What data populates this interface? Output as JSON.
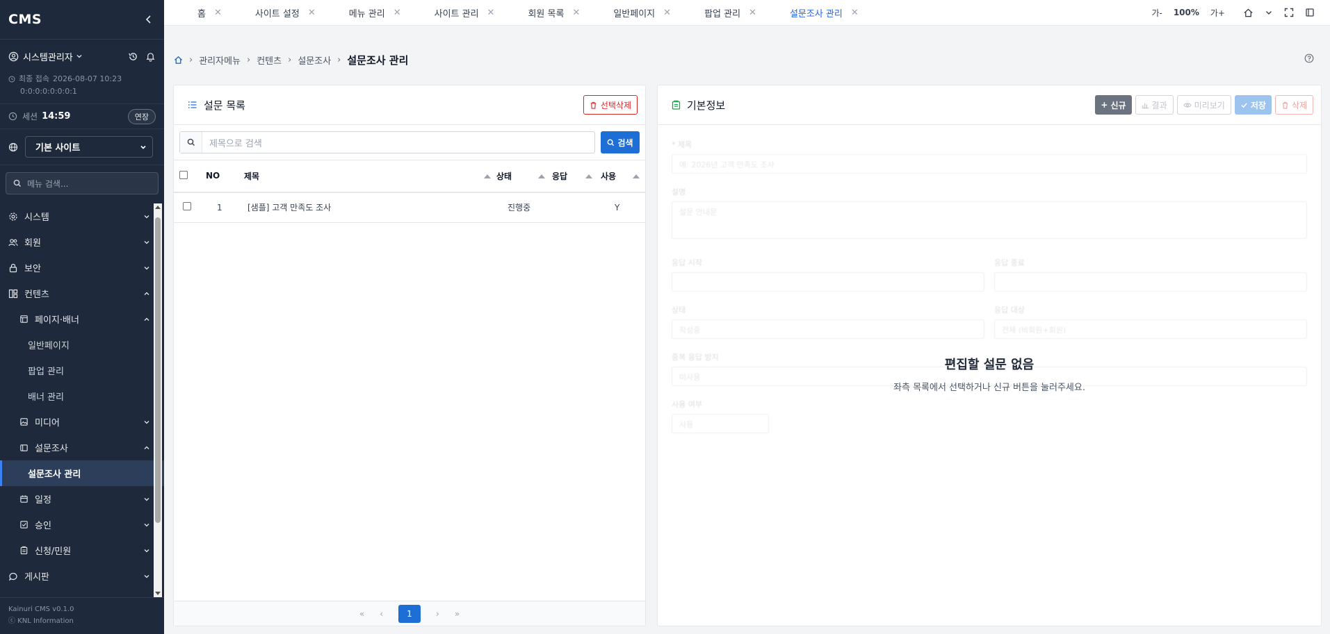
{
  "sidebar": {
    "brand": "CMS",
    "user_name": "시스템관리자",
    "last_login_label": "최종 접속",
    "last_login_time": "2026-08-07 10:23",
    "last_login_ip": "0:0:0:0:0:0:0:1",
    "session_label": "세션",
    "session_time": "14:59",
    "extend_label": "연장",
    "site_select": "기본 사이트",
    "menu_search_placeholder": "메뉴 검색...",
    "menu": [
      {
        "label": "시스템",
        "icon": "gear-icon",
        "expanded": false
      },
      {
        "label": "회원",
        "icon": "users-icon",
        "expanded": false
      },
      {
        "label": "보안",
        "icon": "lock-icon",
        "expanded": false
      },
      {
        "label": "컨텐츠",
        "icon": "grid-icon",
        "expanded": true
      },
      {
        "label": "페이지·배너",
        "icon": "page-icon",
        "expanded": true
      },
      {
        "label": "일반페이지"
      },
      {
        "label": "팝업 관리"
      },
      {
        "label": "배너 관리"
      },
      {
        "label": "미디어",
        "icon": "image-icon",
        "expanded": false
      },
      {
        "label": "설문조사",
        "icon": "survey-icon",
        "expanded": true
      },
      {
        "label": "설문조사 관리",
        "active": true
      },
      {
        "label": "일정",
        "icon": "calendar-icon",
        "expanded": false
      },
      {
        "label": "승인",
        "icon": "check-square-icon",
        "expanded": false
      },
      {
        "label": "신청/민원",
        "icon": "clipboard-icon",
        "expanded": false
      },
      {
        "label": "게시판",
        "icon": "chat-icon",
        "expanded": false
      }
    ],
    "footer_version": "Kainuri CMS v0.1.0",
    "footer_company": "ⓒ KNL Information"
  },
  "tabs": [
    {
      "label": "홈"
    },
    {
      "label": "사이트 설정"
    },
    {
      "label": "메뉴 관리"
    },
    {
      "label": "사이트 관리"
    },
    {
      "label": "회원 목록"
    },
    {
      "label": "일반페이지"
    },
    {
      "label": "팝업 관리"
    },
    {
      "label": "설문조사 관리",
      "active": true
    }
  ],
  "toolbar": {
    "font_down": "가-",
    "zoom": "100%",
    "font_up": "가+"
  },
  "breadcrumb": [
    "관리자메뉴",
    "컨텐츠",
    "설문조사",
    "설문조사 관리"
  ],
  "list_panel": {
    "title": "설문 목록",
    "delete_selected": "선택삭제",
    "search_placeholder": "제목으로 검색",
    "search_button": "검색",
    "columns": {
      "no": "NO",
      "title": "제목",
      "status": "상태",
      "responses": "응답",
      "use": "사용"
    },
    "rows": [
      {
        "no": "1",
        "title": "[샘플] 고객 만족도 조사",
        "status": "진행중",
        "responses": "",
        "use": "Y"
      }
    ],
    "pagination": {
      "first": "«",
      "prev": "‹",
      "current": "1",
      "next": "›",
      "last": "»"
    }
  },
  "detail_panel": {
    "title": "기본정보",
    "buttons": {
      "new": "신규",
      "result": "결과",
      "preview": "미리보기",
      "save": "저장",
      "delete": "삭제"
    },
    "empty_title": "편집할 설문 없음",
    "empty_message": "좌측 목록에서 선택하거나 신규 버튼을 눌러주세요.",
    "form": {
      "title_label": "* 제목",
      "title_placeholder": "예: 2026년 고객 만족도 조사",
      "desc_label": "설명",
      "desc_placeholder": "설문 안내문",
      "start_label": "응답 시작",
      "end_label": "응답 종료",
      "status_label": "상태",
      "status_value": "작성중",
      "target_label": "응답 대상",
      "target_value": "전체 (비회원+회원)",
      "dup_label": "중복 응답 방지",
      "dup_value": "미사용",
      "use_label": "사용 여부",
      "use_value": "사용"
    }
  },
  "colors": {
    "sidebar_bg": "#1e2a3b",
    "primary": "#1d6fd6",
    "danger": "#dc2626",
    "active_tab": "#2563eb"
  }
}
